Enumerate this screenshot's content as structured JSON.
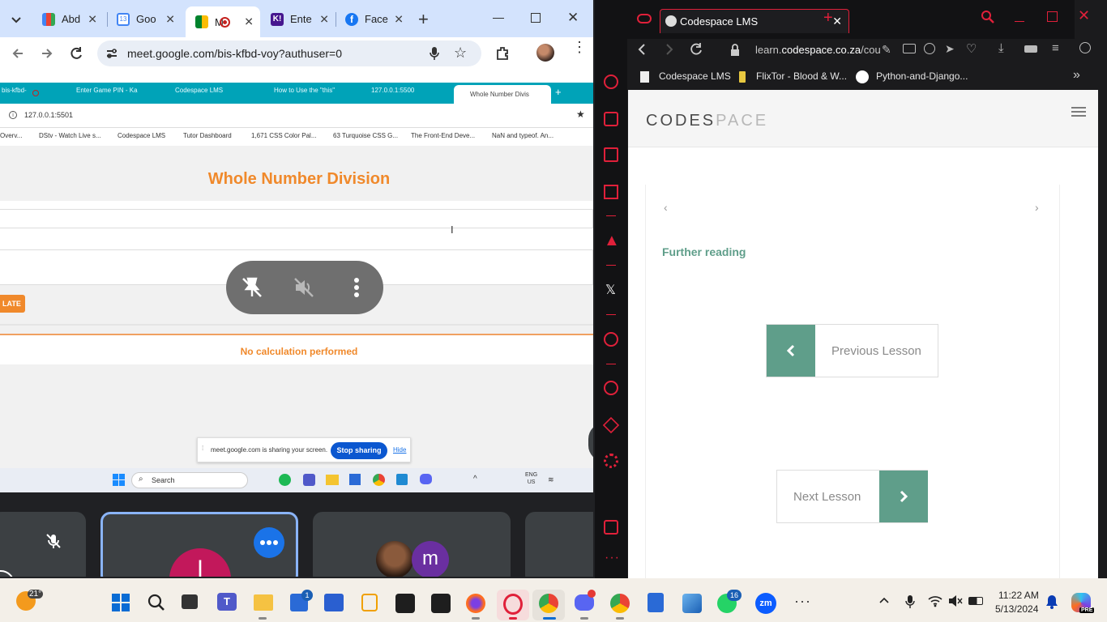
{
  "left_browser": {
    "tabs": [
      {
        "label": "Abd"
      },
      {
        "label": "Goo"
      },
      {
        "label": "M"
      },
      {
        "label": "Ente"
      },
      {
        "label": "Face"
      }
    ],
    "url": "meet.google.com/bis-kfbd-voy?authuser=0"
  },
  "shared_screen": {
    "tabs": [
      "bis-kfbd-",
      "Enter Game PIN - Ka",
      "Codespace LMS",
      "How to Use the \"this\"",
      "127.0.0.1:5500",
      "Whole Number Divis"
    ],
    "address": "127.0.0.1:5501",
    "bookmarks": [
      "Overv...",
      "DStv - Watch Live s...",
      "Codespace LMS",
      "Tutor Dashboard",
      "1,671 CSS Color Pal...",
      "63 Turquoise CSS G...",
      "The Front-End Deve...",
      "NaN and typeof. An..."
    ],
    "heading": "Whole Number Division",
    "calculate_label": "LATE",
    "result": "No calculation performed",
    "share_notice": "meet.google.com is sharing your screen.",
    "stop_sharing": "Stop sharing",
    "hide": "Hide",
    "taskbar_search": "Search",
    "lang": "ENG",
    "lang_region": "US"
  },
  "meet": {
    "participant_initial": "l",
    "participant_m": "m"
  },
  "right_browser": {
    "tab_label": "Codespace LMS",
    "url_host": "learn.",
    "url_domain": "codespace.co.za",
    "url_path": "/cou",
    "bookmarks": [
      "Codespace LMS",
      "FlixTor - Blood & W...",
      "Python-and-Django..."
    ],
    "logo_code": "CODES",
    "logo_space": "PACE",
    "further_reading": "Further reading",
    "prev_label": "Previous Lesson",
    "next_label": "Next Lesson"
  },
  "taskbar": {
    "weather_temp": "21°",
    "store_badge": "1",
    "whatsapp_badge": "16",
    "time": "11:22 AM",
    "date": "5/13/2024",
    "copilot_badge": "PRE"
  },
  "colors": {
    "accent_orange": "#f0892b",
    "teal": "#5f9e8a",
    "opera_red": "#e0203a",
    "inner_tab_teal": "#00a3b8"
  }
}
